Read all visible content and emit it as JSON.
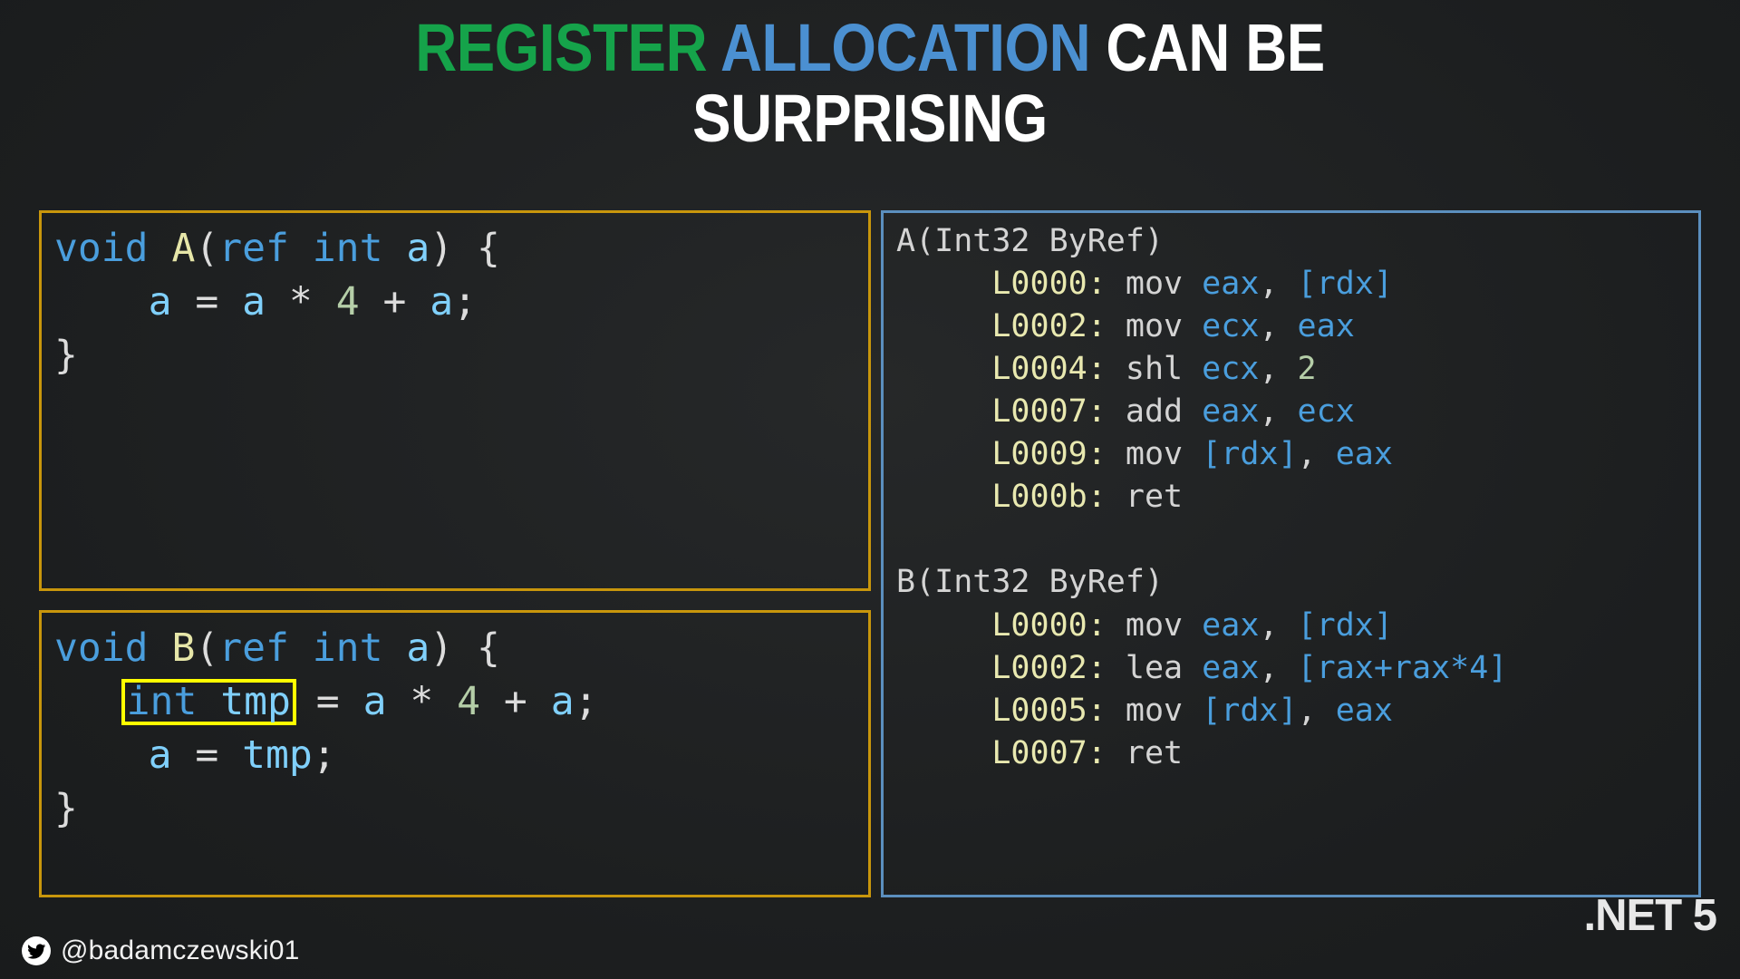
{
  "slide": {
    "background_color": "#202223",
    "title": {
      "line1_part1": "REGISTER",
      "line1_part1_color": "#15a34a",
      "line1_part2": "ALLOCATION",
      "line1_part2_color": "#4b90d1",
      "line1_part3": "CAN BE",
      "line1_part3_color": "#ffffff",
      "line2": "SURPRISING",
      "line2_color": "#ffffff"
    }
  },
  "code_panel_a": {
    "border_color": "#c8960c",
    "lines": {
      "l1_kw_void": "void",
      "l1_fn": "A",
      "l1_open": "(",
      "l1_kw_ref": "ref",
      "l1_kw_int": "int",
      "l1_param": "a",
      "l1_close": ")",
      "l1_brace": "{",
      "l2_var1": "a",
      "l2_eq": "=",
      "l2_var2": "a",
      "l2_mul": "*",
      "l2_num": "4",
      "l2_plus": "+",
      "l2_var3": "a",
      "l2_semi": ";",
      "l3_brace": "}"
    }
  },
  "code_panel_b": {
    "border_color": "#c8960c",
    "highlight_color": "#ffff00",
    "lines": {
      "l1_kw_void": "void",
      "l1_fn": "B",
      "l1_open": "(",
      "l1_kw_ref": "ref",
      "l1_kw_int": "int",
      "l1_param": "a",
      "l1_close": ")",
      "l1_brace": "{",
      "l2_hl_kw": "int",
      "l2_hl_id": "tmp",
      "l2_eq": "=",
      "l2_var1": "a",
      "l2_mul": "*",
      "l2_num": "4",
      "l2_plus": "+",
      "l2_var2": "a",
      "l2_semi": ";",
      "l3_var": "a",
      "l3_eq": "=",
      "l3_tmp": "tmp",
      "l3_semi": ";",
      "l4_brace": "}"
    }
  },
  "asm_panel": {
    "border_color": "#5b8fbe",
    "method_a": {
      "header": "A(Int32 ByRef)",
      "instructions": [
        {
          "label": "L0000:",
          "mnemonic": "mov",
          "op1": "eax",
          "comma": ",",
          "op2": "[rdx]"
        },
        {
          "label": "L0002:",
          "mnemonic": "mov",
          "op1": "ecx",
          "comma": ",",
          "op2": "eax"
        },
        {
          "label": "L0004:",
          "mnemonic": "shl",
          "op1": "ecx",
          "comma": ",",
          "op2": "2"
        },
        {
          "label": "L0007:",
          "mnemonic": "add",
          "op1": "eax",
          "comma": ",",
          "op2": "ecx"
        },
        {
          "label": "L0009:",
          "mnemonic": "mov",
          "op1": "[rdx]",
          "comma": ",",
          "op2": "eax"
        },
        {
          "label": "L000b:",
          "mnemonic": "ret",
          "op1": "",
          "comma": "",
          "op2": ""
        }
      ]
    },
    "method_b": {
      "header": "B(Int32 ByRef)",
      "instructions": [
        {
          "label": "L0000:",
          "mnemonic": "mov",
          "op1": "eax",
          "comma": ",",
          "op2": "[rdx]"
        },
        {
          "label": "L0002:",
          "mnemonic": "lea",
          "op1": "eax",
          "comma": ",",
          "op2": "[rax+rax*4]"
        },
        {
          "label": "L0005:",
          "mnemonic": "mov",
          "op1": "[rdx]",
          "comma": ",",
          "op2": "eax"
        },
        {
          "label": "L0007:",
          "mnemonic": "ret",
          "op1": "",
          "comma": "",
          "op2": ""
        }
      ]
    }
  },
  "footer": {
    "twitter_handle": "@badamczewski01",
    "framework_label": ".NET 5"
  }
}
